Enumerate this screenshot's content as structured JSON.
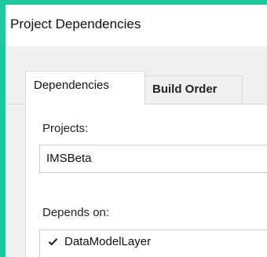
{
  "dialog": {
    "title": "Project Dependencies"
  },
  "tabs": [
    {
      "label": "Dependencies",
      "selected": true
    },
    {
      "label": "Build Order",
      "selected": false
    }
  ],
  "projects": {
    "label": "Projects:",
    "selected_value": "IMSBeta"
  },
  "depends_on": {
    "label": "Depends on:",
    "items": [
      {
        "label": "DataModelLayer",
        "checked": true
      }
    ]
  },
  "colors": {
    "background_accent": "#1fc9a0",
    "dialog_bg": "#f0f0f0",
    "panel_bg": "#ffffff"
  }
}
